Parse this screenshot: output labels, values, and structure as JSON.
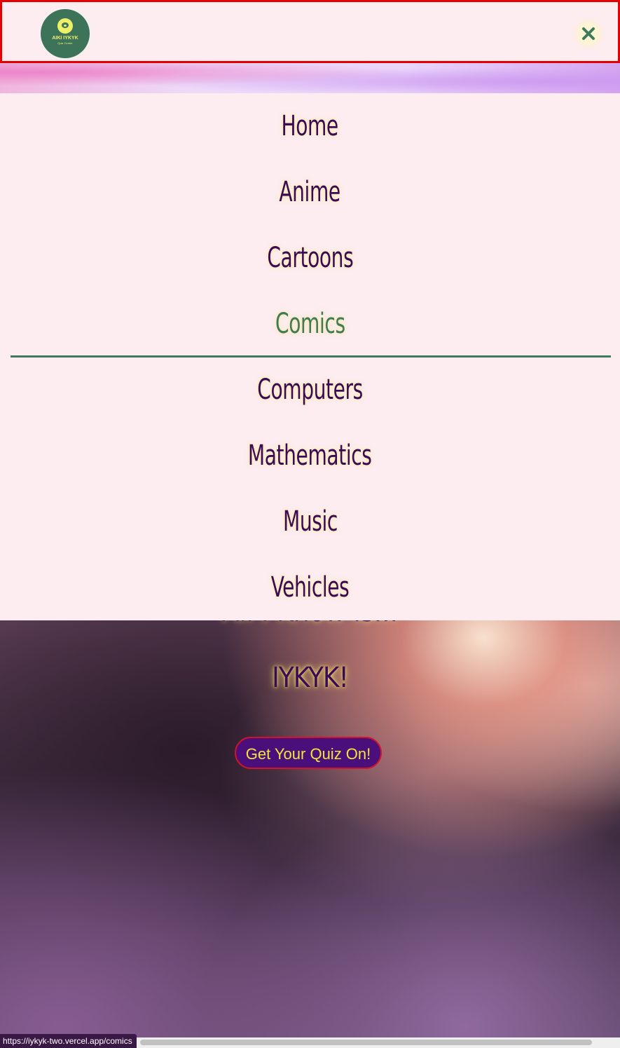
{
  "header": {
    "logo_text": "AIKI IYKYK",
    "logo_subtext": "Quiz Center",
    "close_icon": "close-x-icon"
  },
  "menu": {
    "items": [
      {
        "label": "Home",
        "active": false
      },
      {
        "label": "Anime",
        "active": false
      },
      {
        "label": "Cartoons",
        "active": false
      },
      {
        "label": "Comics",
        "active": true
      },
      {
        "label": "Computers",
        "active": false
      },
      {
        "label": "Mathematics",
        "active": false
      },
      {
        "label": "Music",
        "active": false
      },
      {
        "label": "Vehicles",
        "active": false
      }
    ]
  },
  "hero": {
    "partially_hidden_line": "All I Know Is...",
    "title": "IYKYK!",
    "cta_label": "Get Your Quiz On!"
  },
  "status_bar": {
    "url": "https://iykyk-two.vercel.app/comics"
  },
  "colors": {
    "menu_background": "#fdecf0",
    "menu_text": "#3a0a58",
    "active_text": "#3f7a5c",
    "header_border": "#e20000",
    "cta_background": "#4a0f7a",
    "cta_text": "#f3e43a",
    "logo_background": "#3d7358"
  }
}
